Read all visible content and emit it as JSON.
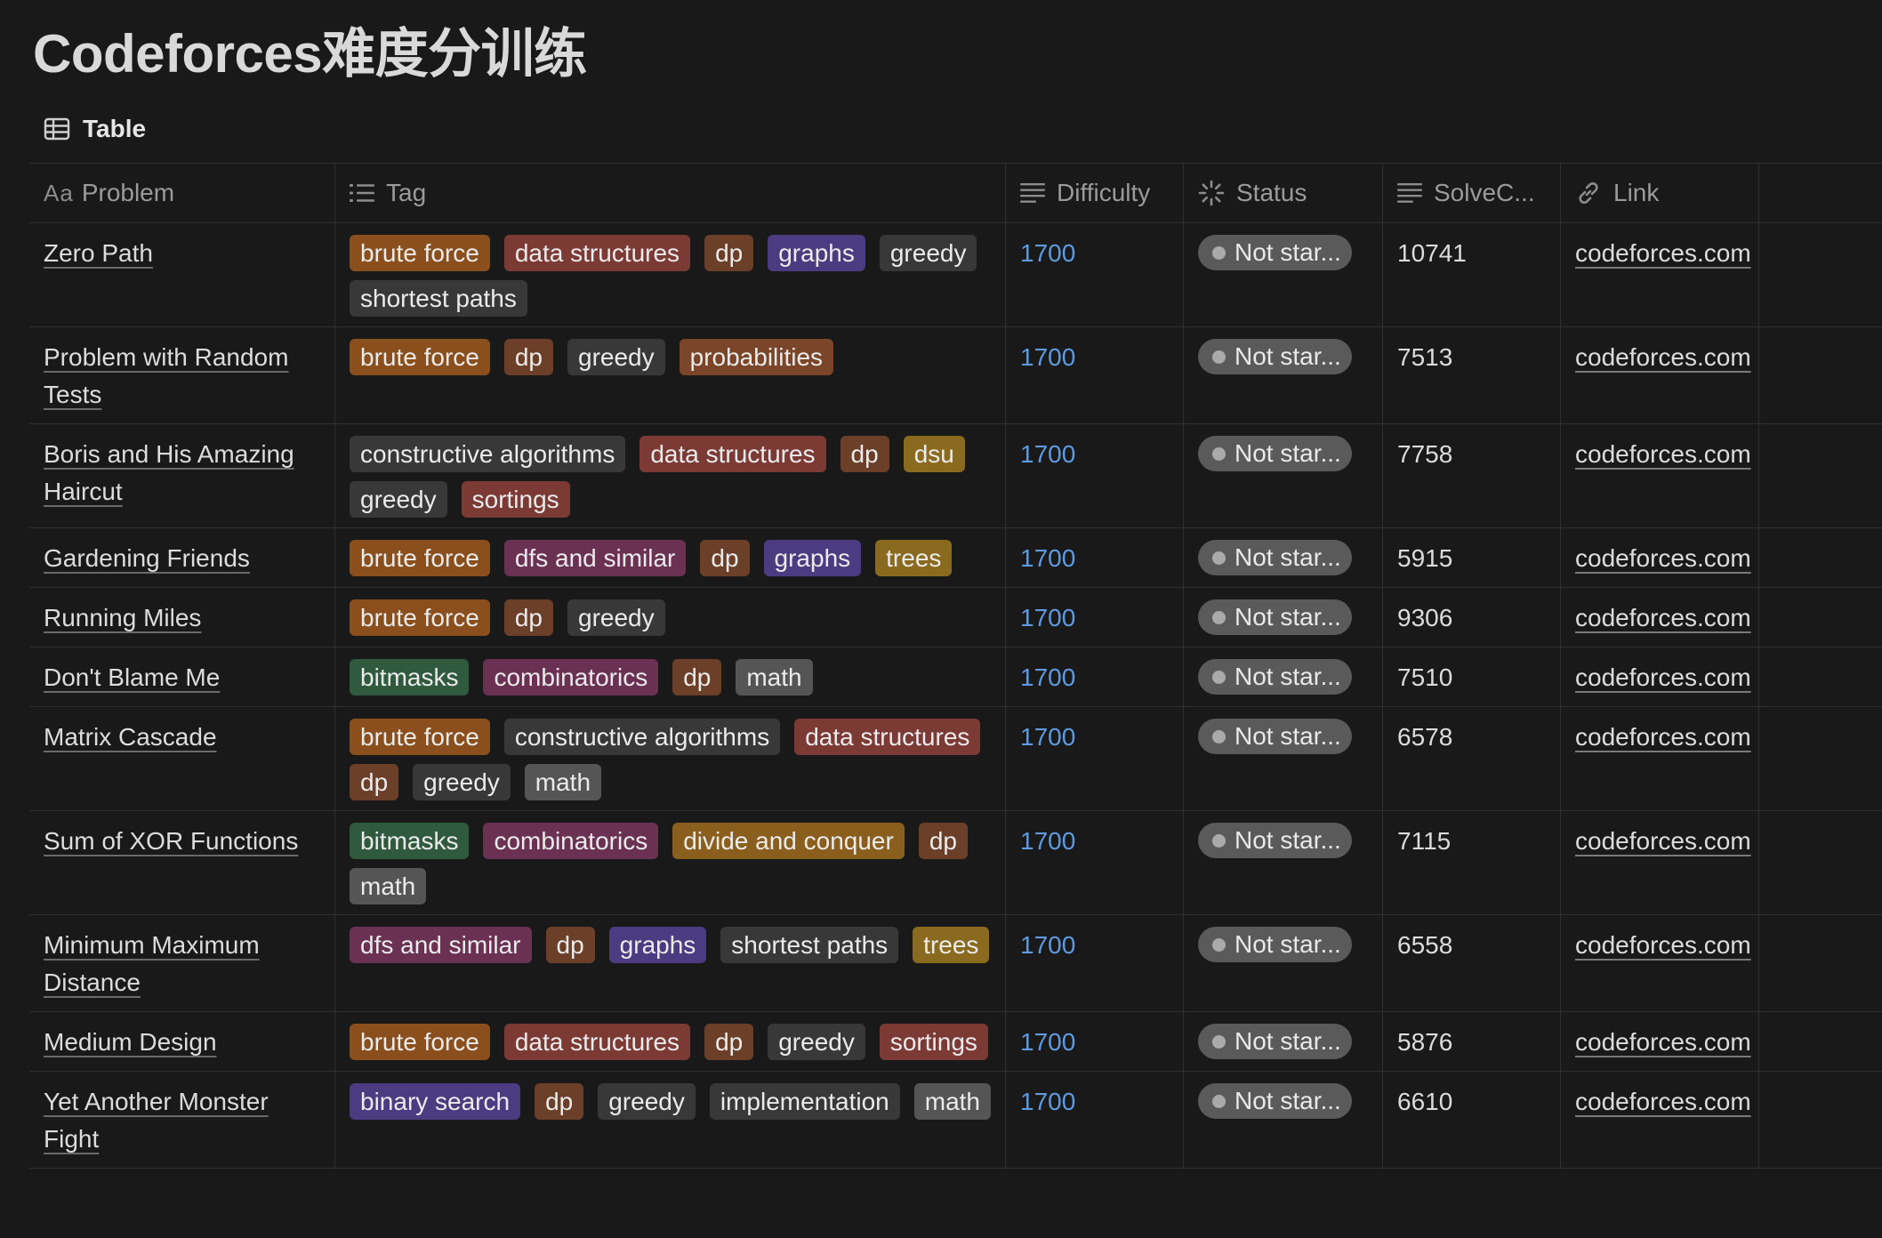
{
  "page": {
    "title": "Codeforces难度分训练"
  },
  "view": {
    "label": "Table",
    "icon": "table-icon"
  },
  "columns": {
    "problem": {
      "prefix": "Aa",
      "label": "Problem"
    },
    "tag": {
      "label": "Tag",
      "icon": "list-icon"
    },
    "difficulty": {
      "label": "Difficulty",
      "icon": "text-lines-icon"
    },
    "status": {
      "label": "Status",
      "icon": "loading-spinner-icon"
    },
    "solve": {
      "label": "SolveC...",
      "icon": "text-lines-icon"
    },
    "link": {
      "label": "Link",
      "icon": "link-icon"
    }
  },
  "tag_colors": {
    "brute force": "#8a4f1c",
    "data structures": "#7c3a35",
    "dp": "#6b3f28",
    "graphs": "#4b3b80",
    "greedy": "#383838",
    "shortest paths": "#383838",
    "probabilities": "#7a4528",
    "constructive algorithms": "#383838",
    "dsu": "#8a6a1e",
    "sortings": "#7c3a35",
    "dfs and similar": "#6b3153",
    "trees": "#8a6a1e",
    "bitmasks": "#2f5a3e",
    "combinatorics": "#6b3153",
    "math": "#555555",
    "divide and conquer": "#8a5f1e",
    "binary search": "#4b3b80",
    "implementation": "#383838"
  },
  "rows": [
    {
      "problem": "Zero Path",
      "tags": [
        "brute force",
        "data structures",
        "dp",
        "graphs",
        "greedy",
        "shortest paths"
      ],
      "difficulty": "1700",
      "status": "Not star...",
      "solve": "10741",
      "link": "codeforces.com"
    },
    {
      "problem": "Problem with Random Tests",
      "tags": [
        "brute force",
        "dp",
        "greedy",
        "probabilities"
      ],
      "difficulty": "1700",
      "status": "Not star...",
      "solve": "7513",
      "link": "codeforces.com"
    },
    {
      "problem": "Boris and His Amazing Haircut",
      "tags": [
        "constructive algorithms",
        "data structures",
        "dp",
        "dsu",
        "greedy",
        "sortings"
      ],
      "difficulty": "1700",
      "status": "Not star...",
      "solve": "7758",
      "link": "codeforces.com"
    },
    {
      "problem": "Gardening Friends",
      "tags": [
        "brute force",
        "dfs and similar",
        "dp",
        "graphs",
        "trees"
      ],
      "difficulty": "1700",
      "status": "Not star...",
      "solve": "5915",
      "link": "codeforces.com"
    },
    {
      "problem": "Running Miles",
      "tags": [
        "brute force",
        "dp",
        "greedy"
      ],
      "difficulty": "1700",
      "status": "Not star...",
      "solve": "9306",
      "link": "codeforces.com"
    },
    {
      "problem": "Don't Blame Me",
      "tags": [
        "bitmasks",
        "combinatorics",
        "dp",
        "math"
      ],
      "difficulty": "1700",
      "status": "Not star...",
      "solve": "7510",
      "link": "codeforces.com"
    },
    {
      "problem": "Matrix Cascade",
      "tags": [
        "brute force",
        "constructive algorithms",
        "data structures",
        "dp",
        "greedy",
        "math"
      ],
      "difficulty": "1700",
      "status": "Not star...",
      "solve": "6578",
      "link": "codeforces.com"
    },
    {
      "problem": "Sum of XOR Functions",
      "tags": [
        "bitmasks",
        "combinatorics",
        "divide and conquer",
        "dp",
        "math"
      ],
      "difficulty": "1700",
      "status": "Not star...",
      "solve": "7115",
      "link": "codeforces.com"
    },
    {
      "problem": "Minimum Maximum Distance",
      "tags": [
        "dfs and similar",
        "dp",
        "graphs",
        "shortest paths",
        "trees"
      ],
      "difficulty": "1700",
      "status": "Not star...",
      "solve": "6558",
      "link": "codeforces.com"
    },
    {
      "problem": "Medium Design",
      "tags": [
        "brute force",
        "data structures",
        "dp",
        "greedy",
        "sortings"
      ],
      "difficulty": "1700",
      "status": "Not star...",
      "solve": "5876",
      "link": "codeforces.com"
    },
    {
      "problem": "Yet Another Monster Fight",
      "tags": [
        "binary search",
        "dp",
        "greedy",
        "implementation",
        "math"
      ],
      "difficulty": "1700",
      "status": "Not star...",
      "solve": "6610",
      "link": "codeforces.com"
    }
  ]
}
